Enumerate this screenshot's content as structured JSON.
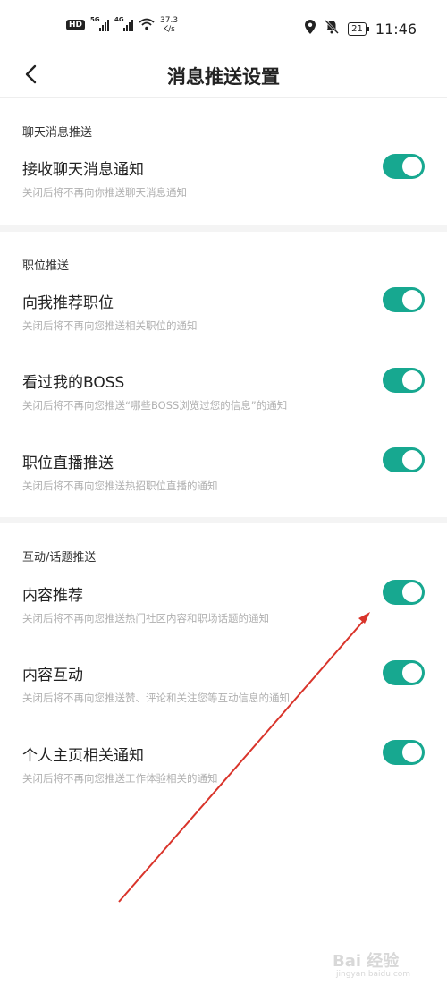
{
  "status_bar": {
    "network_speed": "37.3",
    "network_speed_unit": "K/s",
    "time": "11:46",
    "battery": "21",
    "hd_label": "HD",
    "sim1_label": "5G",
    "sim2_label": "4G"
  },
  "header": {
    "title": "消息推送设置"
  },
  "sections": [
    {
      "header": "聊天消息推送",
      "items": [
        {
          "title": "接收聊天消息通知",
          "subtitle": "关闭后将不再向你推送聊天消息通知",
          "enabled": true
        }
      ]
    },
    {
      "header": "职位推送",
      "items": [
        {
          "title": "向我推荐职位",
          "subtitle": "关闭后将不再向您推送相关职位的通知",
          "enabled": true
        },
        {
          "title": "看过我的BOSS",
          "subtitle": "关闭后将不再向您推送“哪些BOSS浏览过您的信息”的通知",
          "enabled": true
        },
        {
          "title": "职位直播推送",
          "subtitle": "关闭后将不再向您推送热招职位直播的通知",
          "enabled": true
        }
      ]
    },
    {
      "header": "互动/话题推送",
      "items": [
        {
          "title": "内容推荐",
          "subtitle": "关闭后将不再向您推送热门社区内容和职场话题的通知",
          "enabled": true
        },
        {
          "title": "内容互动",
          "subtitle": "关闭后将不再向您推送赞、评论和关注您等互动信息的通知",
          "enabled": true
        },
        {
          "title": "个人主页相关通知",
          "subtitle": "关闭后将不再向您推送工作体验相关的通知",
          "enabled": true
        }
      ]
    }
  ],
  "colors": {
    "toggle_on": "#17a890",
    "annotation_arrow": "#d9342b"
  },
  "watermark": {
    "text": "Bai 经验",
    "sub": "jingyan.baidu.com"
  }
}
